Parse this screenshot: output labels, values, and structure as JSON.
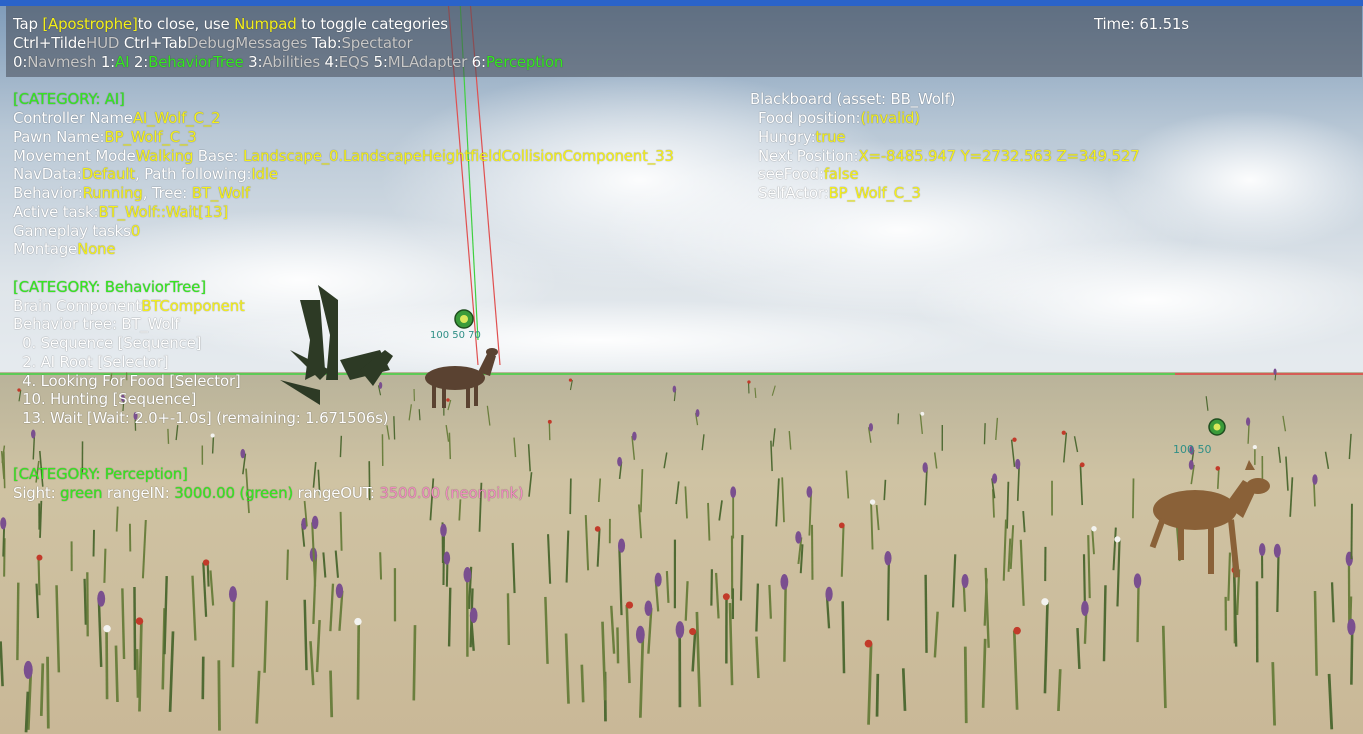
{
  "hud": {
    "line1": {
      "a": "Tap ",
      "b": "[Apostrophe]",
      "c": "to close, use",
      "d": "Numpad",
      "e": "to toggle categories"
    },
    "time": "Time: 61.51s",
    "line2": {
      "a": "Ctrl+Tilde",
      "b": "HUD",
      "c": "Ctrl+Tab",
      "d": "DebugMessages",
      "e": "Tab:",
      "f": "Spectator"
    },
    "line3": [
      {
        "num": "0:",
        "label": "Navmesh",
        "active": false
      },
      {
        "num": "1:",
        "label": "AI",
        "active": true
      },
      {
        "num": "2:",
        "label": "BehaviorTree",
        "active": true
      },
      {
        "num": "3:",
        "label": "Abilities",
        "active": false
      },
      {
        "num": "4:",
        "label": "EQS",
        "active": false
      },
      {
        "num": "5:",
        "label": "MLAdapter",
        "active": false
      },
      {
        "num": "6:",
        "label": "Perception",
        "active": true
      }
    ]
  },
  "ai": {
    "header": "[CATEGORY: AI]",
    "controller_label": "Controller Name",
    "controller_value": "AI_Wolf_C_2",
    "pawn_label": "Pawn Name:",
    "pawn_value": "BP_Wolf_C_3",
    "movement_label": "Movement Mode",
    "movement_value": "Walking",
    "base_label": " Base: ",
    "base_value": "Landscape_0.LandscapeHeightfieldCollisionComponent_33",
    "navdata_label": "NavData:",
    "navdata_value": "Default",
    "path_label": ", Path following:",
    "path_value": "Idle",
    "behavior_label": "Behavior:",
    "behavior_value": "Running",
    "tree_label": ", Tree: ",
    "tree_value": "BT_Wolf",
    "task_label": "Active task:",
    "task_value": "BT_Wolf::Wait[13]",
    "gameplay_label": "Gameplay tasks",
    "gameplay_value": "0",
    "montage_label": "Montage",
    "montage_value": "None"
  },
  "bt": {
    "header": "[CATEGORY: BehaviorTree]",
    "brain_label": "Brain Component",
    "brain_value": "BTComponent",
    "tree_line": "Behavior tree: BT_Wolf",
    "nodes": [
      "  0. Sequence [Sequence]",
      "  2. AI Root [Selector]",
      "  4. Looking For Food [Selector]",
      "  10. Hunting [Sequence]",
      "  13. Wait [Wait: 2.0+-1.0s] (remaining: 1.671506s)"
    ]
  },
  "perception": {
    "header": "[CATEGORY: Perception]",
    "sight_label": "Sight: ",
    "sight_value": "green",
    "range_in_label": " rangeIN: ",
    "range_in_value": "3000.00 (green)",
    "range_out_label": " rangeOUT: ",
    "range_out_value": "3500.00 (neonpink)"
  },
  "blackboard": {
    "title": "Blackboard (asset: BB_Wolf)",
    "entries": [
      {
        "key": "Food position:",
        "value": "(invalid)"
      },
      {
        "key": "Hungry:",
        "value": "true"
      },
      {
        "key": "Next Position:",
        "value": "X=-8485.947 Y=2732.563 Z=349.527"
      },
      {
        "key": "seeFood:",
        "value": "false"
      },
      {
        "key": "SelfActor:",
        "value": "BP_Wolf_C_3"
      }
    ]
  },
  "world_labels": {
    "deer1_hp": "100 50  70",
    "deer2_hp": "100  50"
  },
  "colors": {
    "yellow": "#f5f01a",
    "green": "#35e820",
    "gray": "#c8c8c8",
    "pink": "#f08cc0",
    "sky_top": "#8da7c2",
    "sand": "#cbbd9c"
  }
}
